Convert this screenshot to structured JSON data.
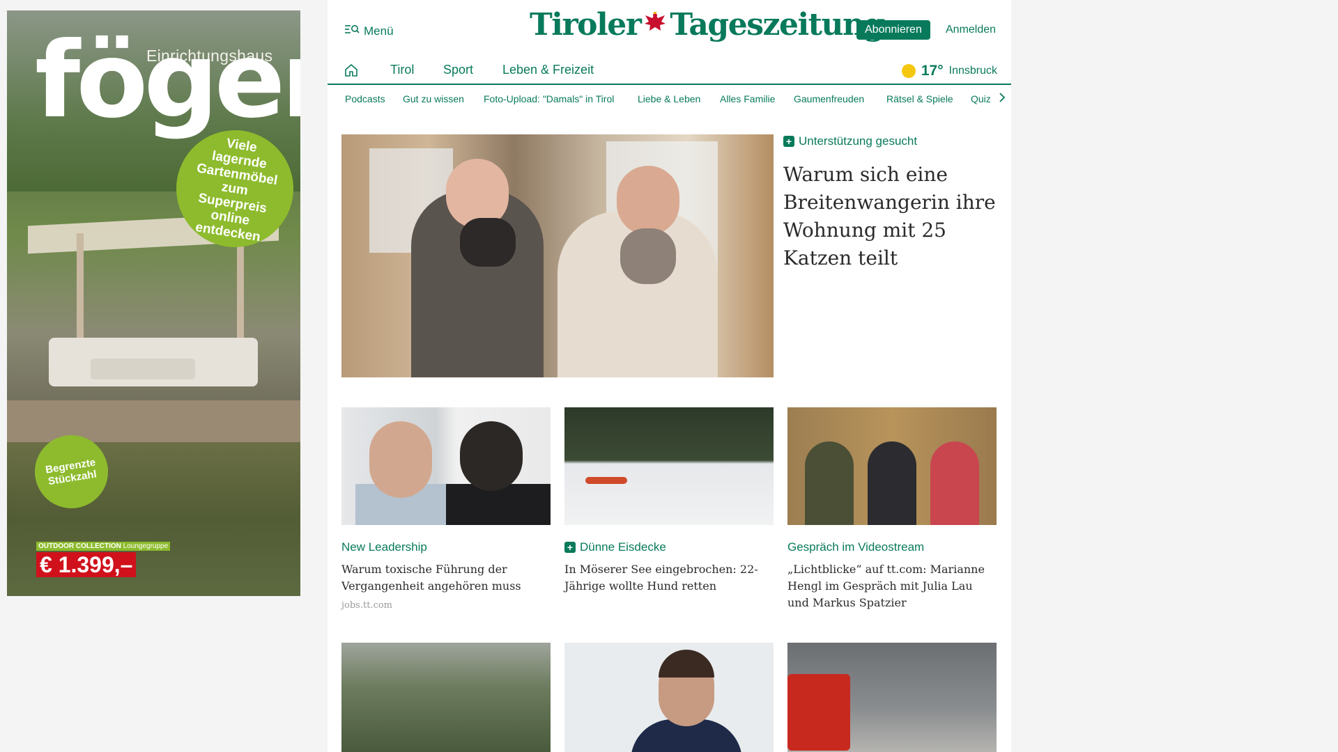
{
  "ad": {
    "brand_sub": "Einrichtungshaus",
    "brand": "föger",
    "badge_big": "Viele lagernde Gartenmöbel zum Superpreis online entdecken",
    "badge_small": "Begrenzte Stückzahl",
    "collection": "OUTDOOR COLLECTION",
    "collection_item": "Loungegruppe",
    "price": "€ 1.399,–",
    "accent_color": "#8dbb2d",
    "price_color": "#d0111b"
  },
  "header": {
    "menu_label": "Menü",
    "logo_left": "Tiroler",
    "logo_right": "Tageszeitung",
    "subscribe_label": "Abonnieren",
    "login_label": "Anmelden",
    "brand_color": "#087a5b"
  },
  "nav": {
    "items": [
      "Tirol",
      "Sport",
      "Leben & Freizeit"
    ],
    "weather": {
      "temp": "17°",
      "city": "Innsbruck",
      "icon": "sun-icon"
    }
  },
  "subnav": {
    "items": [
      "Podcasts",
      "Gut zu wissen",
      "Foto-Upload: \"Damals\" in Tirol",
      "Liebe & Leben",
      "Alles Familie",
      "Gaumenfreuden",
      "Rätsel & Spiele",
      "Quiz"
    ]
  },
  "hero": {
    "kicker": "Unterstützung gesucht",
    "title": "Warum sich eine Breitenwangerin ihre Wohnung mit 25 Katzen teilt"
  },
  "cards": [
    {
      "kicker": "New Leadership",
      "premium": false,
      "title": "Warum toxische Führung der Vergangenheit angehören muss",
      "source": "jobs.tt.com"
    },
    {
      "kicker": "Dünne Eisdecke",
      "premium": true,
      "title": "In Möserer See eingebrochen: 22-Jährige wollte Hund retten"
    },
    {
      "kicker": "Gespräch im Videostream",
      "premium": false,
      "title": "„Lichtblicke“ auf tt.com: Marianne Hengl im Gespräch mit Julia Lau und Markus Spatzier"
    }
  ]
}
